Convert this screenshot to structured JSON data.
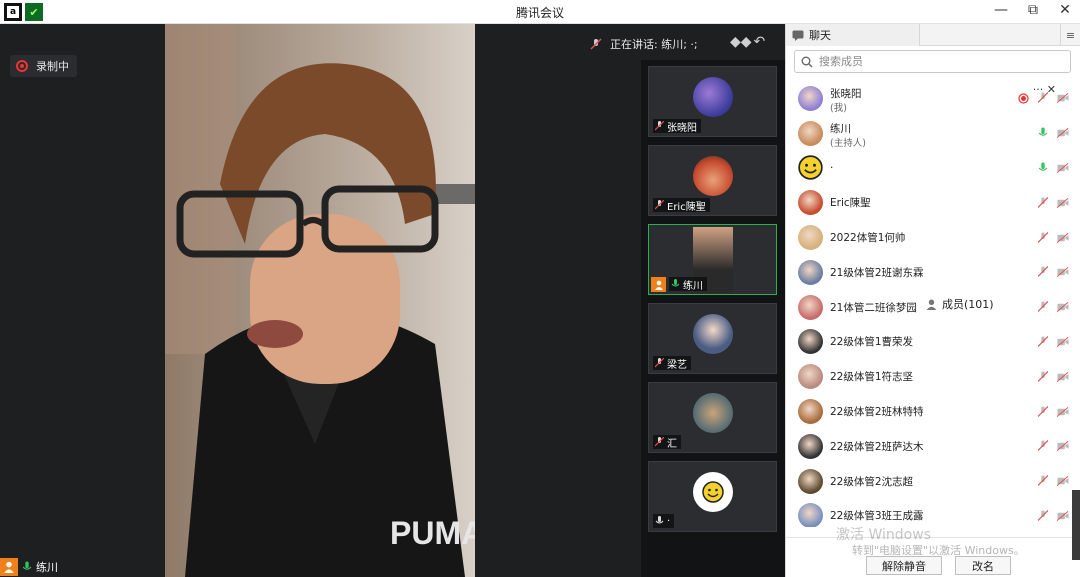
{
  "window": {
    "title": "腾讯会议",
    "controls": [
      "—",
      "⧉",
      "✕"
    ]
  },
  "stage": {
    "recording_label": "录制中",
    "speaking_label": "正在讲话: 练川; ·;",
    "main_speaker_name": "练川"
  },
  "tiles": [
    {
      "name": "张晓阳",
      "mic": "muted"
    },
    {
      "name": "Eric陳聖",
      "mic": "muted"
    },
    {
      "name": "练川",
      "mic": "on",
      "host": true
    },
    {
      "name": "梁艺",
      "mic": "muted"
    },
    {
      "name": "汇",
      "mic": "muted"
    },
    {
      "name": "·",
      "mic": "on"
    }
  ],
  "sidebar": {
    "tab_chat": "聊天",
    "tab_members": "成员(101)",
    "search_placeholder": "搜索成员",
    "members": [
      {
        "name": "张晓阳",
        "sub": "(我)",
        "mic": "muted",
        "rec": true
      },
      {
        "name": "练川",
        "sub": "(主持人)",
        "mic": "on"
      },
      {
        "name": "·",
        "sub": "",
        "mic": "on"
      },
      {
        "name": "Eric陳聖",
        "sub": "",
        "mic": "muted"
      },
      {
        "name": "2022体管1何帅",
        "sub": "",
        "mic": "muted"
      },
      {
        "name": "21级体管2班谢东霖",
        "sub": "",
        "mic": "muted"
      },
      {
        "name": "21体管二班徐梦园",
        "sub": "",
        "mic": "muted"
      },
      {
        "name": "22级体管1曹荣发",
        "sub": "",
        "mic": "muted"
      },
      {
        "name": "22级体管1符志坚",
        "sub": "",
        "mic": "muted"
      },
      {
        "name": "22级体管2班林特特",
        "sub": "",
        "mic": "muted"
      },
      {
        "name": "22级体管2班萨达木",
        "sub": "",
        "mic": "muted"
      },
      {
        "name": "22级体管2沈志超",
        "sub": "",
        "mic": "muted"
      },
      {
        "name": "22级体管3班王成露",
        "sub": "",
        "mic": "muted"
      }
    ],
    "btn_unmute_all": "解除静音",
    "btn_rename": "改名",
    "watermark_line1": "激活 Windows",
    "watermark_line2": "转到\"电脑设置\"以激活 Windows。"
  },
  "colors": {
    "accent_green": "#26b052",
    "host_orange": "#f08019",
    "rec_red": "#e33333",
    "muted_red": "#e05050"
  }
}
